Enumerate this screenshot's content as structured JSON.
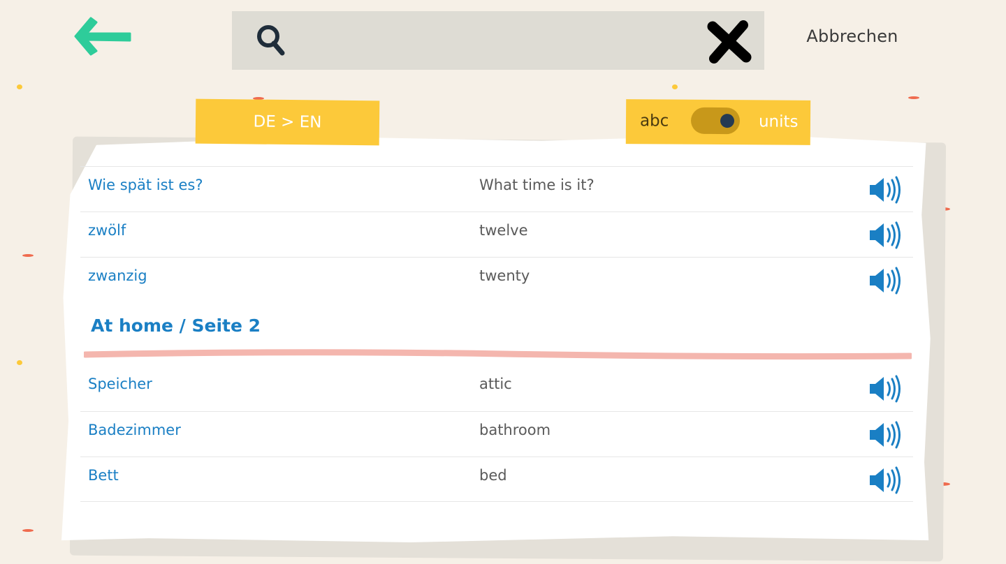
{
  "search": {
    "placeholder": "",
    "value": "",
    "cancel_label": "Abbrechen"
  },
  "filters": {
    "direction_label": "DE > EN",
    "sort_left_label": "abc",
    "sort_right_label": "units",
    "sort_toggle_on": true
  },
  "groups": [
    {
      "title": "",
      "rows": [
        {
          "word": "Wie spät ist es?",
          "translation": "What time is it?"
        },
        {
          "word": "zwölf",
          "translation": "twelve"
        },
        {
          "word": "zwanzig",
          "translation": "twenty"
        }
      ]
    },
    {
      "title": "At home / Seite 2",
      "rows": [
        {
          "word": "Speicher",
          "translation": "attic"
        },
        {
          "word": "Badezimmer",
          "translation": "bathroom"
        },
        {
          "word": "Bett",
          "translation": "bed"
        }
      ]
    }
  ],
  "colors": {
    "background": "#f6f0e7",
    "accent_green": "#2ecc9a",
    "tag_yellow": "#fcc93a",
    "word_blue": "#1a7fc4",
    "divider_pink": "#f4b6ae"
  },
  "icons": {
    "back": "arrow-left-icon",
    "search": "magnifier-icon",
    "clear": "close-x-icon",
    "audio": "speaker-icon"
  }
}
